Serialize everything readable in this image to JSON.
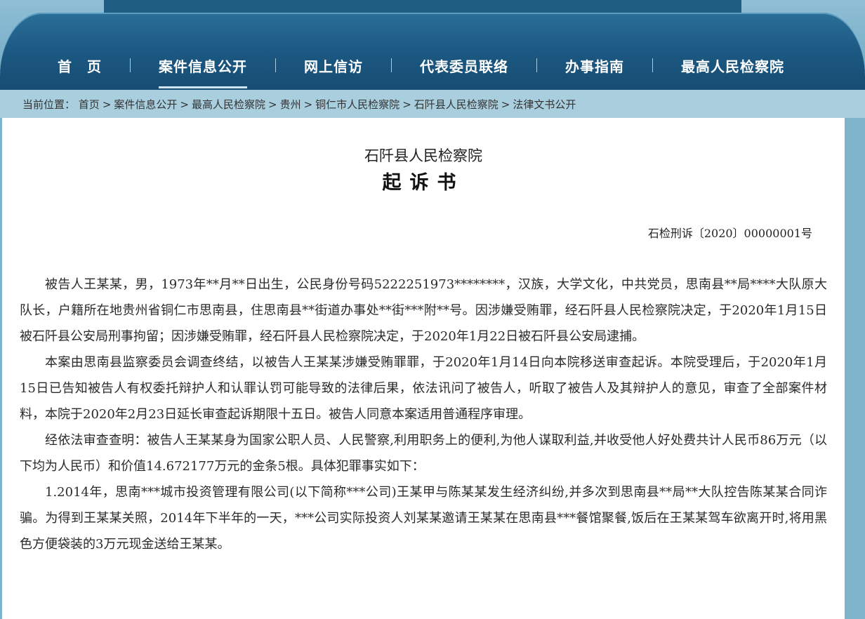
{
  "nav": {
    "items": [
      {
        "label": "首　页"
      },
      {
        "label": "案件信息公开"
      },
      {
        "label": "网上信访"
      },
      {
        "label": "代表委员联络"
      },
      {
        "label": "办事指南"
      },
      {
        "label": "最高人民检察院"
      }
    ]
  },
  "breadcrumb": {
    "prefix": "当前位置：",
    "items": [
      "首页",
      "案件信息公开",
      "最高人民检察院",
      "贵州",
      "铜仁市人民检察院",
      "石阡县人民检察院",
      "法律文书公开"
    ],
    "separator": ">"
  },
  "document": {
    "org": "石阡县人民检察院",
    "title": "起诉书",
    "number": "石检刑诉〔2020〕00000001号",
    "paragraphs": [
      "被告人王某某，男，1973年**月**日出生，公民身份号码5222251973********，汉族，大学文化，中共党员，思南县**局****大队原大队长，户籍所在地贵州省铜仁市思南县，住思南县**街道办事处**街***附**号。因涉嫌受贿罪，经石阡县人民检察院决定，于2020年1月15日被石阡县公安局刑事拘留；因涉嫌受贿罪，经石阡县人民检察院决定，于2020年1月22日被石阡县公安局逮捕。",
      "本案由思南县监察委员会调查终结，以被告人王某某涉嫌受贿罪罪，于2020年1月14日向本院移送审查起诉。本院受理后，于2020年1月15日已告知被告人有权委托辩护人和认罪认罚可能导致的法律后果，依法讯问了被告人，听取了被告人及其辩护人的意见，审查了全部案件材料，本院于2020年2月23日延长审查起诉期限十五日。被告人同意本案适用普通程序审理。",
      "经依法审查查明：被告人王某某身为国家公职人员、人民警察,利用职务上的便利,为他人谋取利益,并收受他人好处费共计人民币86万元（以下均为人民币）和价值14.672177万元的金条5根。具体犯罪事实如下：",
      "1.2014年，思南***城市投资管理有限公司(以下简称***公司)王某甲与陈某某发生经济纠纷,并多次到思南县**局**大队控告陈某某合同诈骗。为得到王某某关照，2014年下半年的一天，***公司实际投资人刘某某邀请王某某在思南县***餐馆聚餐,饭后在王某某驾车欲离开时,将用黑色方便袋装的3万元现金送给王某某。"
    ]
  }
}
